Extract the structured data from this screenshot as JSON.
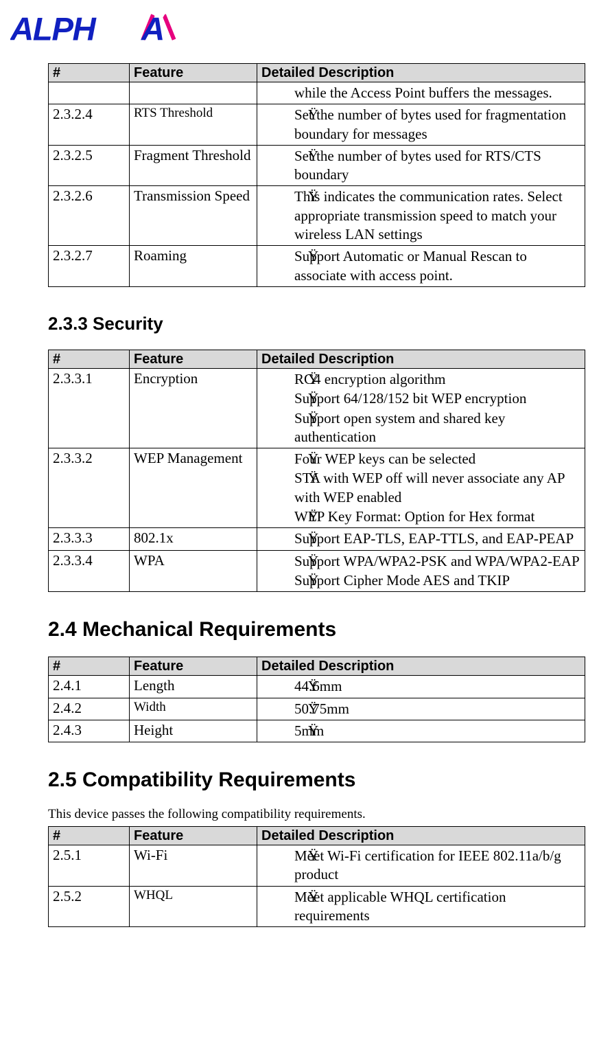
{
  "logo": {
    "text": "ALPHA"
  },
  "table_headers": {
    "num": "#",
    "feature": "Feature",
    "desc": "Detailed Description"
  },
  "tables": {
    "top": {
      "rows": [
        {
          "num": "",
          "feature": "",
          "desc": [
            "while the Access Point buffers the messages."
          ],
          "partial_first": true
        },
        {
          "num": "2.3.2.4",
          "feature": "RTS Threshold",
          "feature_small": true,
          "desc": [
            "Set the number of bytes used for fragmentation boundary for messages"
          ]
        },
        {
          "num": "2.3.2.5",
          "feature": "Fragment Threshold",
          "desc": [
            "Set the number of bytes used for RTS/CTS boundary"
          ]
        },
        {
          "num": "2.3.2.6",
          "feature": "Transmission Speed",
          "desc": [
            "This indicates the communication rates. Select appropriate transmission speed to match your wireless LAN settings"
          ]
        },
        {
          "num": "2.3.2.7",
          "feature": "Roaming",
          "desc": [
            "Support Automatic or Manual Rescan to associate with access point."
          ]
        }
      ]
    },
    "security": {
      "heading": "2.3.3 Security",
      "rows": [
        {
          "num": "2.3.3.1",
          "feature": "Encryption",
          "desc": [
            "RC4 encryption algorithm",
            "Support 64/128/152 bit WEP encryption",
            "Support open system and shared key authentication"
          ]
        },
        {
          "num": "2.3.3.2",
          "feature": "WEP Management",
          "desc": [
            "Four WEP keys can be selected",
            "STA with WEP off will never associate any AP with WEP enabled",
            "WEP Key Format: Option for Hex format"
          ]
        },
        {
          "num": "2.3.3.3",
          "feature": "802.1x",
          "desc": [
            "Support EAP-TLS, EAP-TTLS, and EAP-PEAP"
          ]
        },
        {
          "num": "2.3.3.4",
          "feature": "WPA",
          "desc": [
            "Support WPA/WPA2-PSK and WPA/WPA2-EAP",
            "Support Cipher Mode AES and TKIP"
          ]
        }
      ]
    },
    "mechanical": {
      "heading": "2.4 Mechanical Requirements",
      "rows": [
        {
          "num": "2.4.1",
          "feature": "Length",
          "desc": [
            "44.6mm"
          ]
        },
        {
          "num": "2.4.2",
          "feature": "Width",
          "feature_small": true,
          "desc": [
            "50.75mm"
          ]
        },
        {
          "num": "2.4.3",
          "feature": "Height",
          "desc": [
            "5mm"
          ]
        }
      ]
    },
    "compatibility": {
      "heading": "2.5 Compatibility Requirements",
      "intro": "This device passes the following compatibility requirements.",
      "rows": [
        {
          "num": "2.5.1",
          "feature": "Wi-Fi",
          "desc": [
            "Meet Wi-Fi certification for IEEE 802.11a/b/g product"
          ]
        },
        {
          "num": "2.5.2",
          "feature": "WHQL",
          "feature_small": true,
          "desc": [
            "Meet applicable WHQL certification requirements"
          ]
        }
      ]
    }
  }
}
